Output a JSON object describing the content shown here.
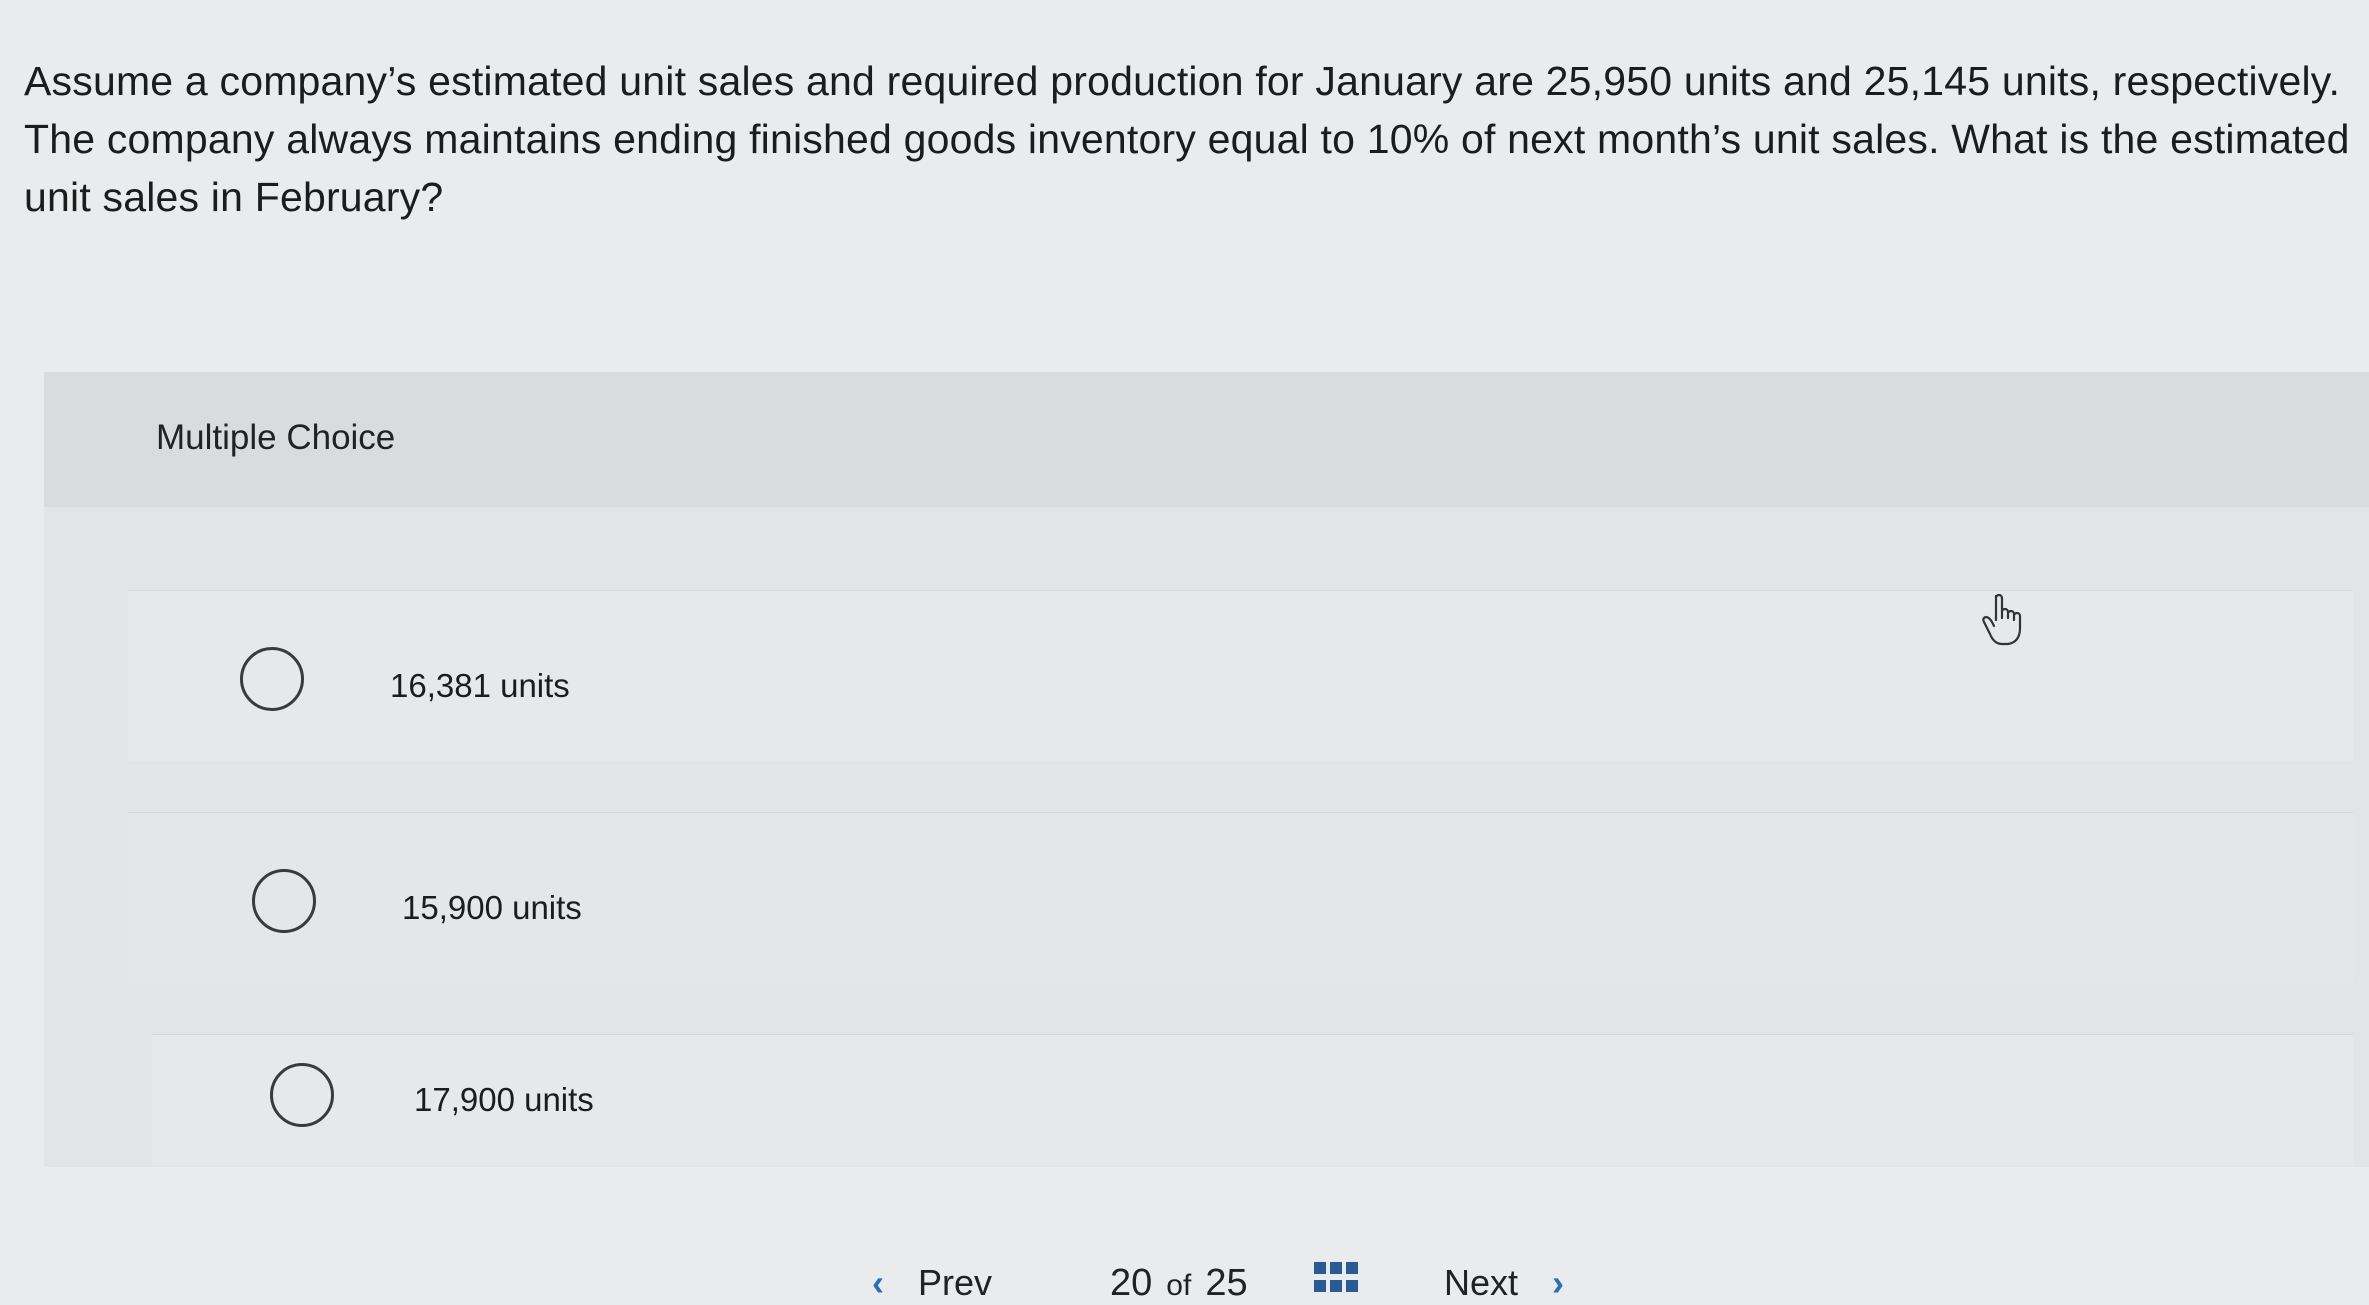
{
  "question": {
    "text": "Assume a company’s estimated unit sales and required production for January are 25,950 units and 25,145 units, respectively. The company always maintains ending finished goods inventory equal to 10% of next month’s unit sales. What is the estimated unit sales in February?"
  },
  "multiple_choice": {
    "title": "Multiple Choice",
    "choices": [
      {
        "label": "16,381 units"
      },
      {
        "label": "15,900 units"
      },
      {
        "label": "17,900 units"
      }
    ]
  },
  "footer": {
    "prev_label": "Prev",
    "prev_icon": "chevron-left-icon",
    "current_page": "20",
    "of_label": "of",
    "total_pages": "25",
    "grid_icon": "question-grid-icon",
    "next_label": "Next",
    "next_icon": "chevron-right-icon"
  },
  "colors": {
    "accent": "#2d6fb3",
    "grid_icon": "#2a5a94"
  }
}
